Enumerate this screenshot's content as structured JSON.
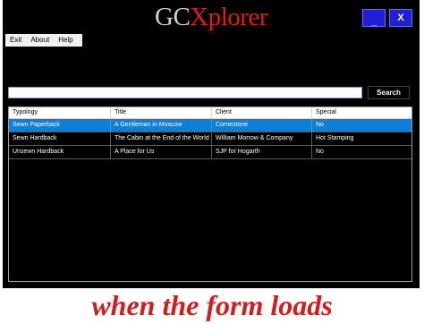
{
  "window": {
    "title_part1": "GC",
    "title_part2": "Xplorer",
    "minimize_label": "_",
    "close_label": "X"
  },
  "menu": {
    "items": [
      {
        "label": "Exit"
      },
      {
        "label": "About"
      },
      {
        "label": "Help"
      }
    ]
  },
  "search": {
    "value": "",
    "placeholder": "",
    "button_label": "Search"
  },
  "grid": {
    "columns": [
      "Typology",
      "Title",
      "Client",
      "Special"
    ],
    "rows": [
      [
        "Sewn Paperback",
        "A Gentleman in Moscow",
        "Cornestone",
        "No"
      ],
      [
        "Sewn Hardback",
        "The Cabin at the End of the World",
        "William Morrow & Company",
        "Hot Stamping"
      ],
      [
        "Unsewn Hardback",
        "A Place for Us",
        "SJP for Hogarth",
        "No"
      ]
    ],
    "selected_row": 0
  },
  "caption": {
    "text": "when the form loads"
  },
  "colors": {
    "background": "#000000",
    "accent_blue": "#1f1fd6",
    "selection": "#0c7fd8",
    "title_red": "#e11b1b",
    "caption_red": "#d81a1a"
  }
}
